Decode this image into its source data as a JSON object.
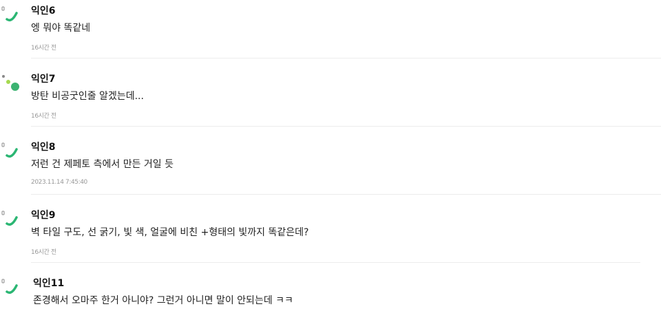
{
  "comments": [
    {
      "author": "익인6",
      "text": "엥 뭐야 똑같네",
      "time": "16시간 전",
      "avatar_icon": "green-arc-icon"
    },
    {
      "author": "익인7",
      "text": "방탄 비공굿인줄 알겠는데...",
      "time": "16시간 전",
      "avatar_icon": "green-dots-icon"
    },
    {
      "author": "익인8",
      "text": "저런 건 제페토 측에서 만든 거일 듯",
      "time": "2023.11.14 7:45:40",
      "avatar_icon": "green-arc-icon"
    },
    {
      "author": "익인9",
      "text": "벽 타일 구도, 선 굵기, 빛 색, 얼굴에 비친 +형태의 빛까지 똑같은데?",
      "time": "16시간 전",
      "avatar_icon": "green-arc-icon"
    },
    {
      "author": "익인11",
      "text": "존경해서 오마주 한거 아니야? 그런거 아니면 말이 안되는데 ㅋㅋ",
      "avatar_icon": "green-arc-icon"
    }
  ],
  "colors": {
    "accent": "#2bb673",
    "dot_light": "#a6d94f",
    "dot_dark": "#3cb371"
  }
}
